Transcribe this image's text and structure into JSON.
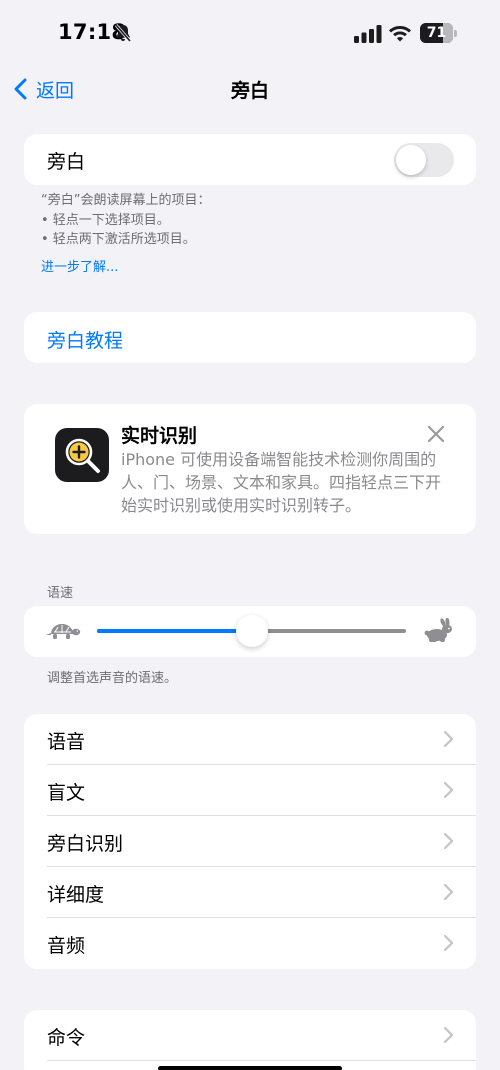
{
  "status_bar": {
    "time": "17:18",
    "battery_level": "71",
    "battery_fraction": 0.71,
    "icons": [
      "bell-slash-icon",
      "signal-icon",
      "wifi-icon",
      "battery-icon"
    ]
  },
  "nav": {
    "back_label": "返回",
    "title": "旁白"
  },
  "voiceover": {
    "label": "旁白",
    "enabled": false,
    "footnote_title": "“旁白”会朗读屏幕上的项目：",
    "footnote_items": [
      "•  轻点一下选择项目。",
      "•  轻点两下激活所选项目。"
    ],
    "learn_more": "进一步了解..."
  },
  "tutorial": {
    "label": "旁白教程"
  },
  "live_recognition": {
    "title": "实时识别",
    "description": "iPhone 可使用设备端智能技术检测你周围的人、门、场景、文本和家具。四指轻点三下开始实时识别或使用实时识别转子。",
    "icon": "magnifier-plus-icon"
  },
  "speaking_rate": {
    "header": "语速",
    "value_fraction": 0.5,
    "footnote": "调整首选声音的语速。",
    "min_icon": "turtle-icon",
    "max_icon": "rabbit-icon"
  },
  "settings_list": [
    {
      "label": "语音"
    },
    {
      "label": "盲文"
    },
    {
      "label": "旁白识别"
    },
    {
      "label": "详细度"
    },
    {
      "label": "音频"
    }
  ],
  "commands_list": [
    {
      "label": "命令"
    }
  ],
  "colors": {
    "accent": "#007aff",
    "background": "#f2f2f7",
    "card": "#ffffff",
    "secondary_text": "#6d6d72"
  }
}
